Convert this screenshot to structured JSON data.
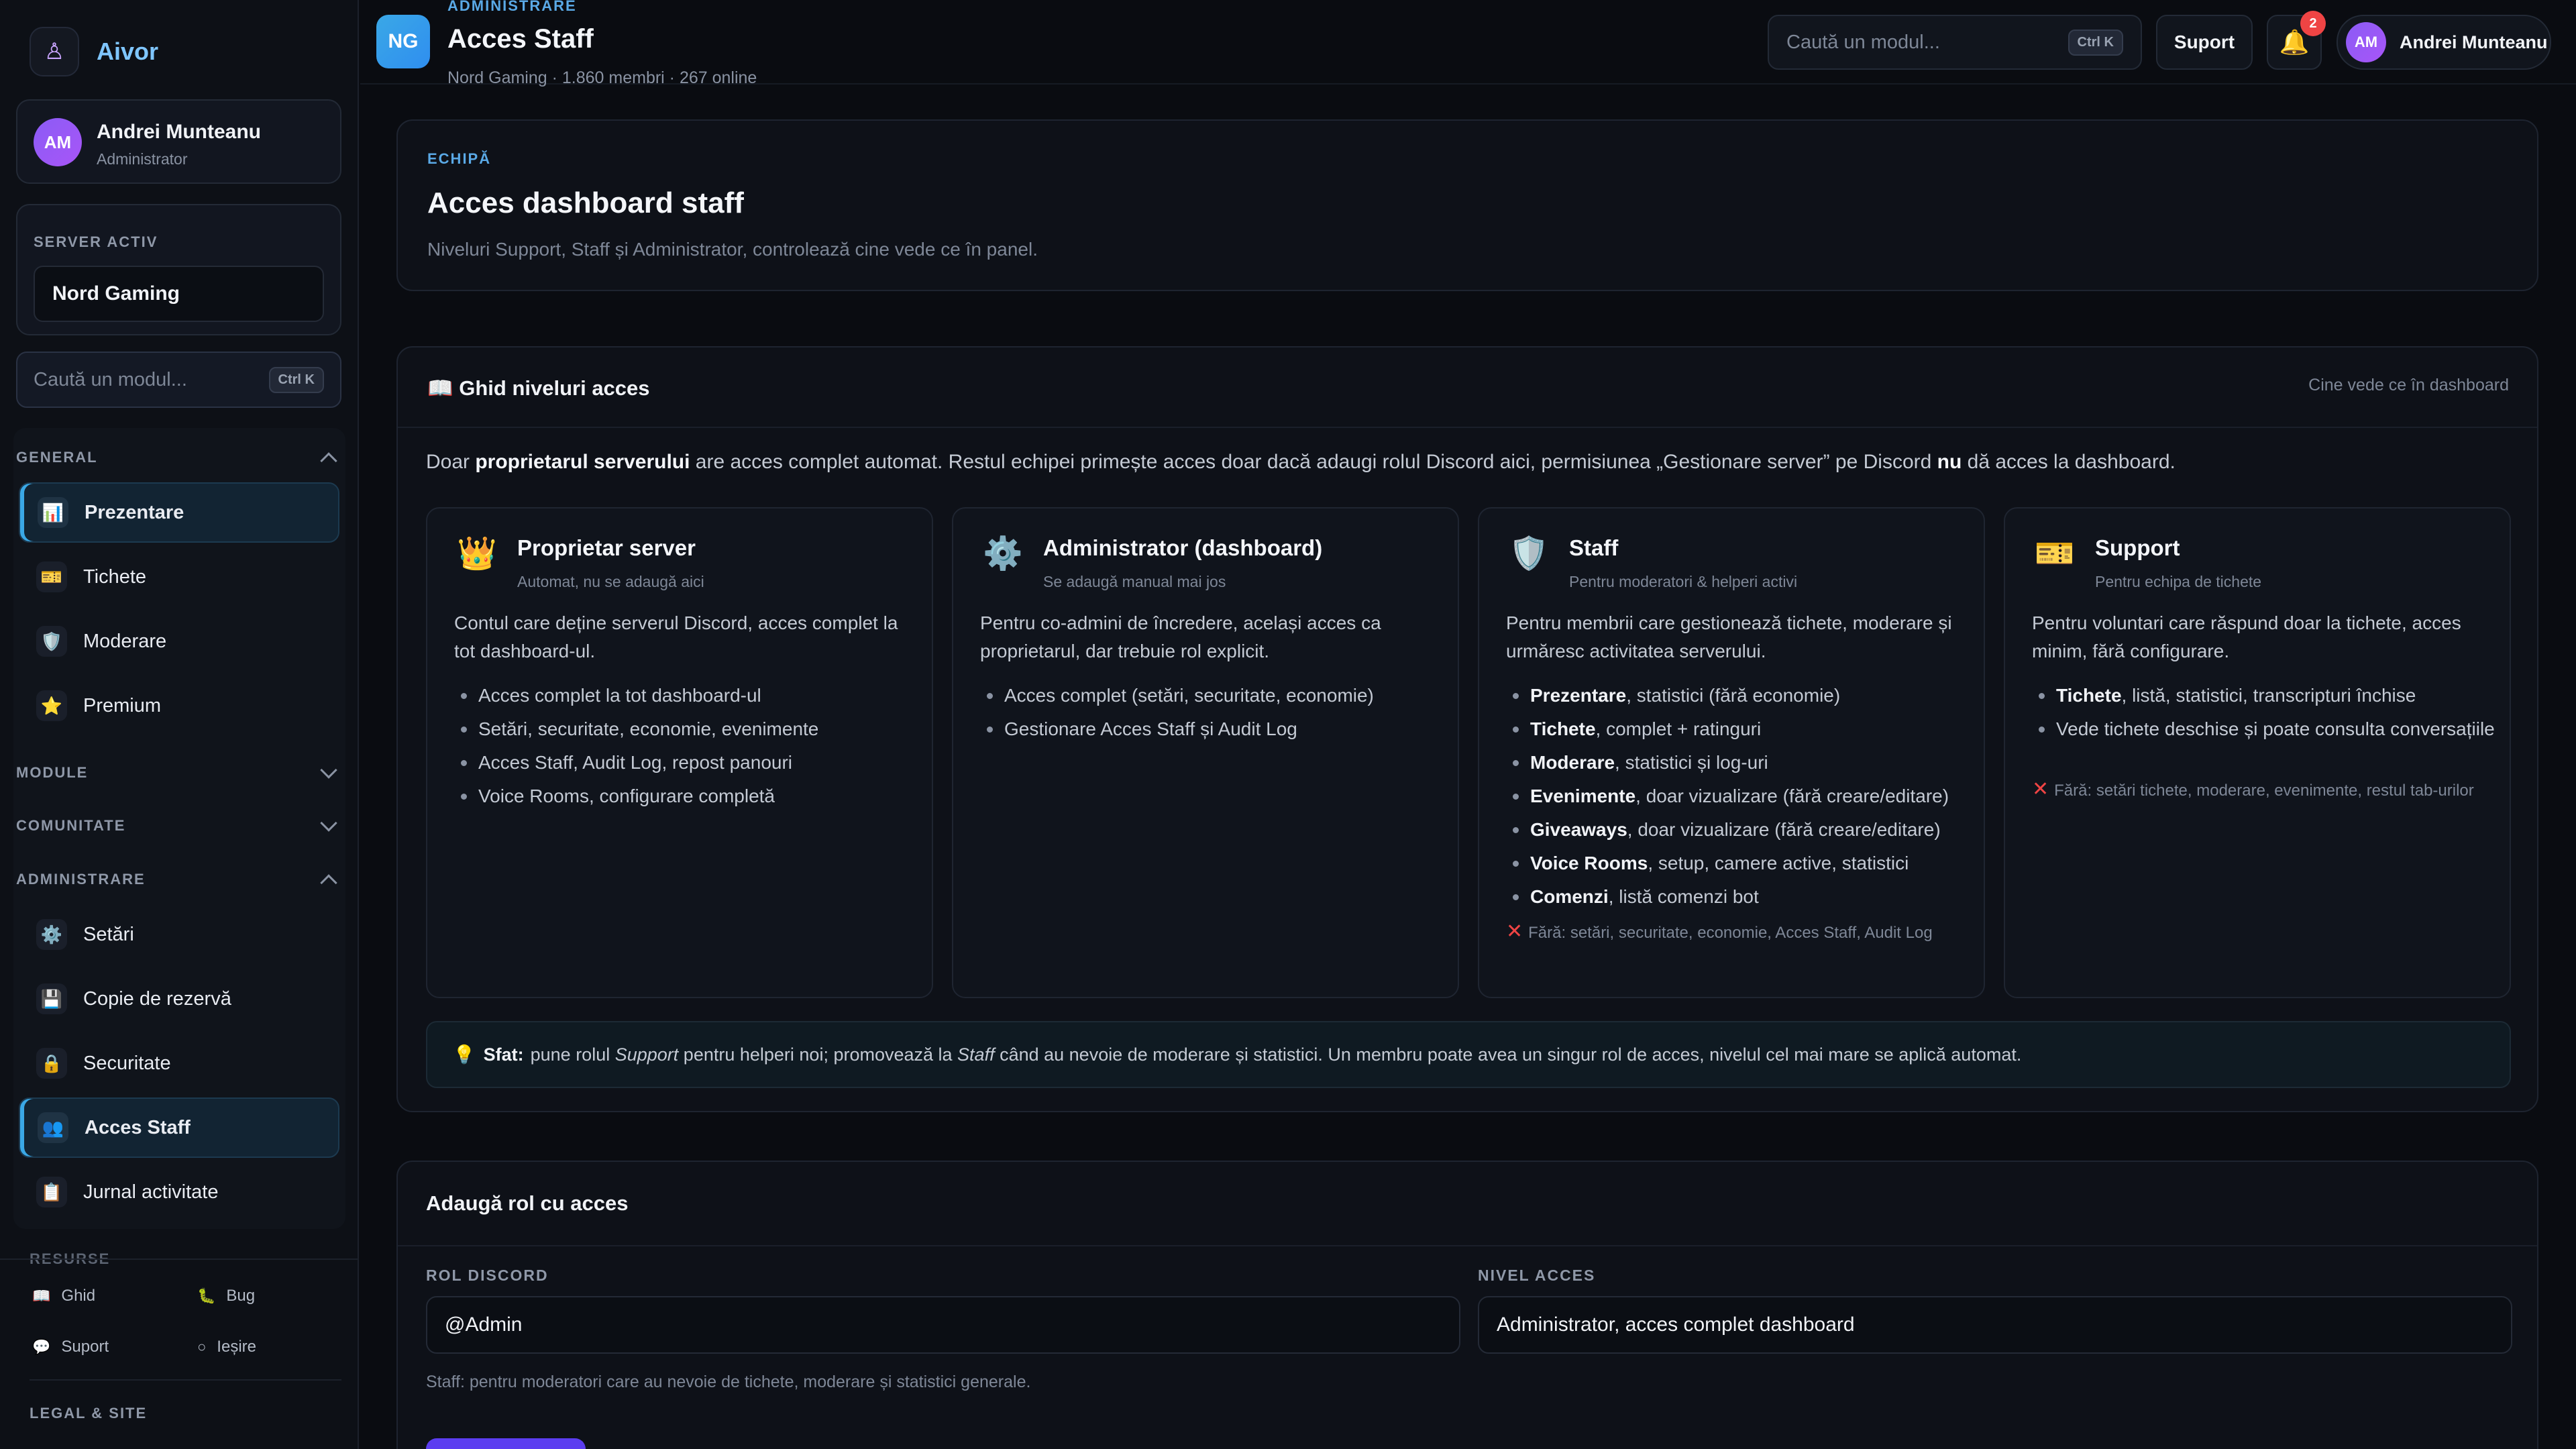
{
  "sidebar": {
    "brand": "Aivor",
    "user": {
      "initials": "AM",
      "name": "Andrei Munteanu",
      "role": "Administrator"
    },
    "server": {
      "label": "SERVER ACTIV",
      "name": "Nord Gaming"
    },
    "search": {
      "placeholder": "Caută un modul...",
      "shortcut": "Ctrl K"
    },
    "sections": {
      "general": "GENERAL",
      "module": "MODULE",
      "comunitate": "COMUNITATE",
      "administrare": "ADMINISTRARE",
      "resurse": "RESURSE",
      "legal": "LEGAL & SITE"
    },
    "general_items": [
      {
        "label": "Prezentare",
        "icon": "📊"
      },
      {
        "label": "Tichete",
        "icon": "🎫"
      },
      {
        "label": "Moderare",
        "icon": "🛡️"
      },
      {
        "label": "Premium",
        "icon": "⭐"
      }
    ],
    "admin_items": [
      {
        "label": "Setări",
        "icon": "⚙️"
      },
      {
        "label": "Copie de rezervă",
        "icon": "💾"
      },
      {
        "label": "Securitate",
        "icon": "🔒"
      },
      {
        "label": "Acces Staff",
        "icon": "👥"
      },
      {
        "label": "Jurnal activitate",
        "icon": "📋"
      }
    ],
    "resources": [
      {
        "label": "Ghid",
        "icon": "📖"
      },
      {
        "label": "Bug",
        "icon": "🐛"
      },
      {
        "label": "Suport",
        "icon": "💬"
      },
      {
        "label": "Ieșire",
        "icon": "○"
      }
    ]
  },
  "topbar": {
    "badge": "NG",
    "breadcrumb": "ADMINISTRARE",
    "title": "Acces Staff",
    "subtitle": "Nord Gaming · 1.860 membri · 267 online",
    "search_placeholder": "Caută un modul...",
    "shortcut": "Ctrl K",
    "support_button": "Suport",
    "notifications_count": "2",
    "user_initials": "AM",
    "user_name": "Andrei Munteanu"
  },
  "intro": {
    "eyebrow": "ECHIPĂ",
    "title": "Acces dashboard staff",
    "description": "Niveluri Support, Staff și Administrator, controlează cine vede ce în panel."
  },
  "guide": {
    "title": "Ghid niveluri acces",
    "title_icon": "📖",
    "right_note": "Cine vede ce în dashboard",
    "lead": {
      "t1": "Doar ",
      "b1": "proprietarul serverului",
      "t2": " are acces complet automat. Restul echipei primește acces doar dacă adaugi rolul Discord aici, permisiunea „Gestionare server” pe Discord ",
      "b2": "nu",
      "t3": " dă acces la dashboard."
    },
    "levels": [
      {
        "icon": "👑",
        "title": "Proprietar server",
        "subtitle": "Automat, nu se adaugă aici",
        "description": "Contul care deține serverul Discord, acces complet la tot dashboard-ul.",
        "items": [
          {
            "bold": "",
            "text": "Acces complet la tot dashboard-ul"
          },
          {
            "bold": "",
            "text": "Setări, securitate, economie, evenimente"
          },
          {
            "bold": "",
            "text": "Acces Staff, Audit Log, repost panouri"
          },
          {
            "bold": "",
            "text": "Voice Rooms, configurare completă"
          }
        ],
        "excluded": ""
      },
      {
        "icon": "⚙️",
        "title": "Administrator (dashboard)",
        "subtitle": "Se adaugă manual mai jos",
        "description": "Pentru co-admini de încredere, același acces ca proprietarul, dar trebuie rol explicit.",
        "items": [
          {
            "bold": "",
            "text": "Acces complet (setări, securitate, economie)"
          },
          {
            "bold": "",
            "text": "Gestionare Acces Staff și Audit Log"
          }
        ],
        "excluded": ""
      },
      {
        "icon": "🛡️",
        "title": "Staff",
        "subtitle": "Pentru moderatori & helperi activi",
        "description": "Pentru membrii care gestionează tichete, moderare și urmăresc activitatea serverului.",
        "items": [
          {
            "bold": "Prezentare",
            "text": ", statistici (fără economie)"
          },
          {
            "bold": "Tichete",
            "text": ", complet + ratinguri"
          },
          {
            "bold": "Moderare",
            "text": ", statistici și log-uri"
          },
          {
            "bold": "Evenimente",
            "text": ", doar vizualizare (fără creare/editare)"
          },
          {
            "bold": "Giveaways",
            "text": ", doar vizualizare (fără creare/editare)"
          },
          {
            "bold": "Voice Rooms",
            "text": ", setup, camere active, statistici"
          },
          {
            "bold": "Comenzi",
            "text": ", listă comenzi bot"
          }
        ],
        "excluded": "Fără: setări, securitate, economie, Acces Staff, Audit Log"
      },
      {
        "icon": "🎫",
        "title": "Support",
        "subtitle": "Pentru echipa de tichete",
        "description": "Pentru voluntari care răspund doar la tichete, acces minim, fără configurare.",
        "items": [
          {
            "bold": "Tichete",
            "text": ", listă, statistici, transcripturi închise"
          },
          {
            "bold": "",
            "text": "Vede tichete deschise și poate consulta conversațiile"
          }
        ],
        "excluded": "Fără: setări tichete, moderare, evenimente, restul tab-urilor"
      }
    ],
    "tip": {
      "icon": "💡",
      "label": "Sfat:",
      "t1": " pune rolul ",
      "i1": "Support",
      "t2": " pentru helperi noi; promovează la ",
      "i2": "Staff",
      "t3": " când au nevoie de moderare și statistici. Un membru poate avea un singur rol de acces, nivelul cel mai mare se aplică automat."
    }
  },
  "add_role": {
    "title": "Adaugă rol cu acces",
    "role_label": "ROL DISCORD",
    "role_value": "@Admin",
    "level_label": "NIVEL ACCES",
    "level_value": "Administrator, acces complet dashboard",
    "hint": "Staff: pentru moderatori care au nevoie de tichete, moderare și statistici generale."
  }
}
